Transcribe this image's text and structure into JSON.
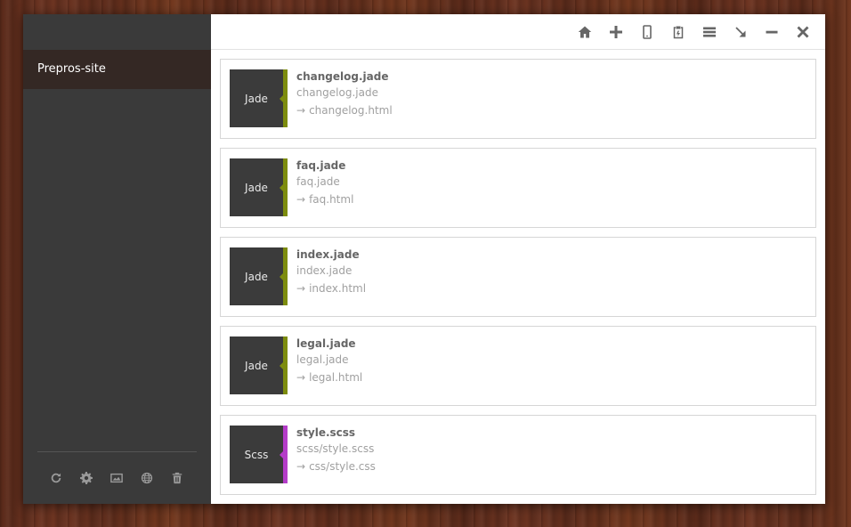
{
  "colors": {
    "jade": "#7d8c0e",
    "scss": "#b43cc8",
    "sidebar_bg": "#3a3a3a",
    "project_bg": "#342824"
  },
  "sidebar": {
    "project_name": "Prepros-site",
    "footer_icons": [
      "refresh-icon",
      "gear-icon",
      "image-icon",
      "globe-icon",
      "trash-icon"
    ]
  },
  "toolbar": {
    "icons": [
      "home-icon",
      "plus-icon",
      "mobile-icon",
      "clipboard-icon",
      "menu-icon",
      "arrow-down-right-icon",
      "minimize-icon",
      "close-icon"
    ]
  },
  "files": [
    {
      "type": "Jade",
      "name": "changelog.jade",
      "path": "changelog.jade",
      "output": "changelog.html",
      "color": "jade"
    },
    {
      "type": "Jade",
      "name": "faq.jade",
      "path": "faq.jade",
      "output": "faq.html",
      "color": "jade"
    },
    {
      "type": "Jade",
      "name": "index.jade",
      "path": "index.jade",
      "output": "index.html",
      "color": "jade"
    },
    {
      "type": "Jade",
      "name": "legal.jade",
      "path": "legal.jade",
      "output": "legal.html",
      "color": "jade"
    },
    {
      "type": "Scss",
      "name": "style.scss",
      "path": "scss/style.scss",
      "output": "css/style.css",
      "color": "scss"
    }
  ],
  "arrow_glyph": "→"
}
